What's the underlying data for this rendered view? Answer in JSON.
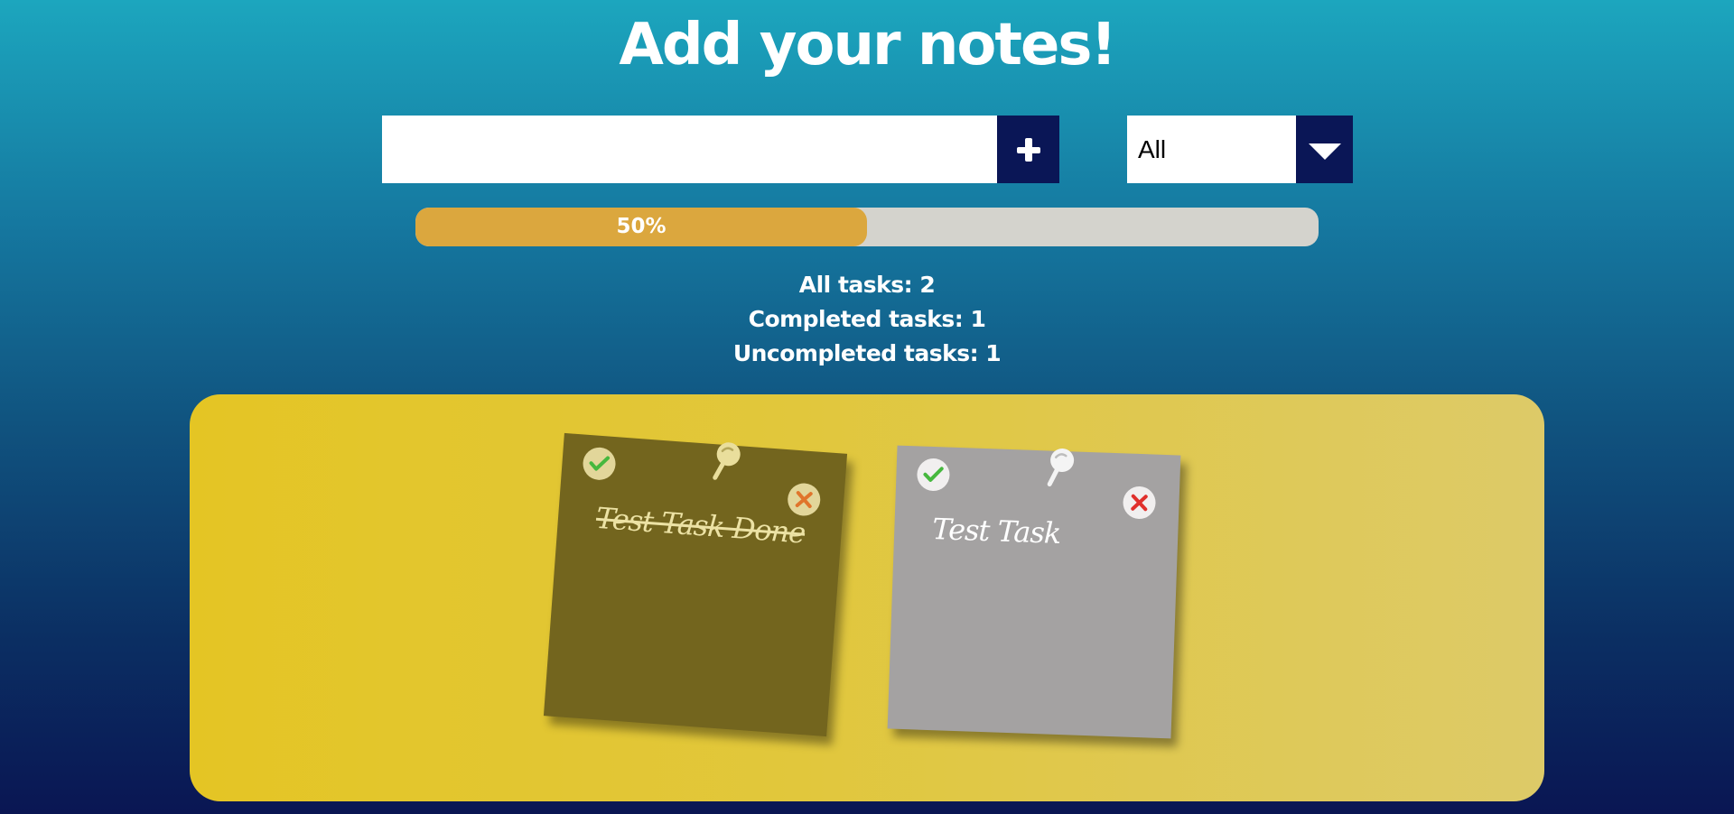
{
  "header": {
    "title": "Add your notes!"
  },
  "note_input": {
    "value": "",
    "placeholder": ""
  },
  "filter": {
    "selected": "All"
  },
  "progress": {
    "percent": 50,
    "label": "50%"
  },
  "stats": {
    "all": "All tasks: 2",
    "completed": "Completed tasks: 1",
    "uncompleted": "Uncompleted tasks: 1"
  },
  "notes": [
    {
      "text": "Test Task Done",
      "done": true,
      "color": "#73651e"
    },
    {
      "text": "Test Task",
      "done": false,
      "color": "#a4a2a2"
    }
  ],
  "colors": {
    "button_bg": "#0a1656",
    "progress_fill": "#dba73e",
    "progress_track": "#d4d3cd",
    "board": "#e1c73c",
    "check_green": "#46b83e",
    "delete_orange": "#e0752c",
    "delete_red": "#e0302c"
  }
}
